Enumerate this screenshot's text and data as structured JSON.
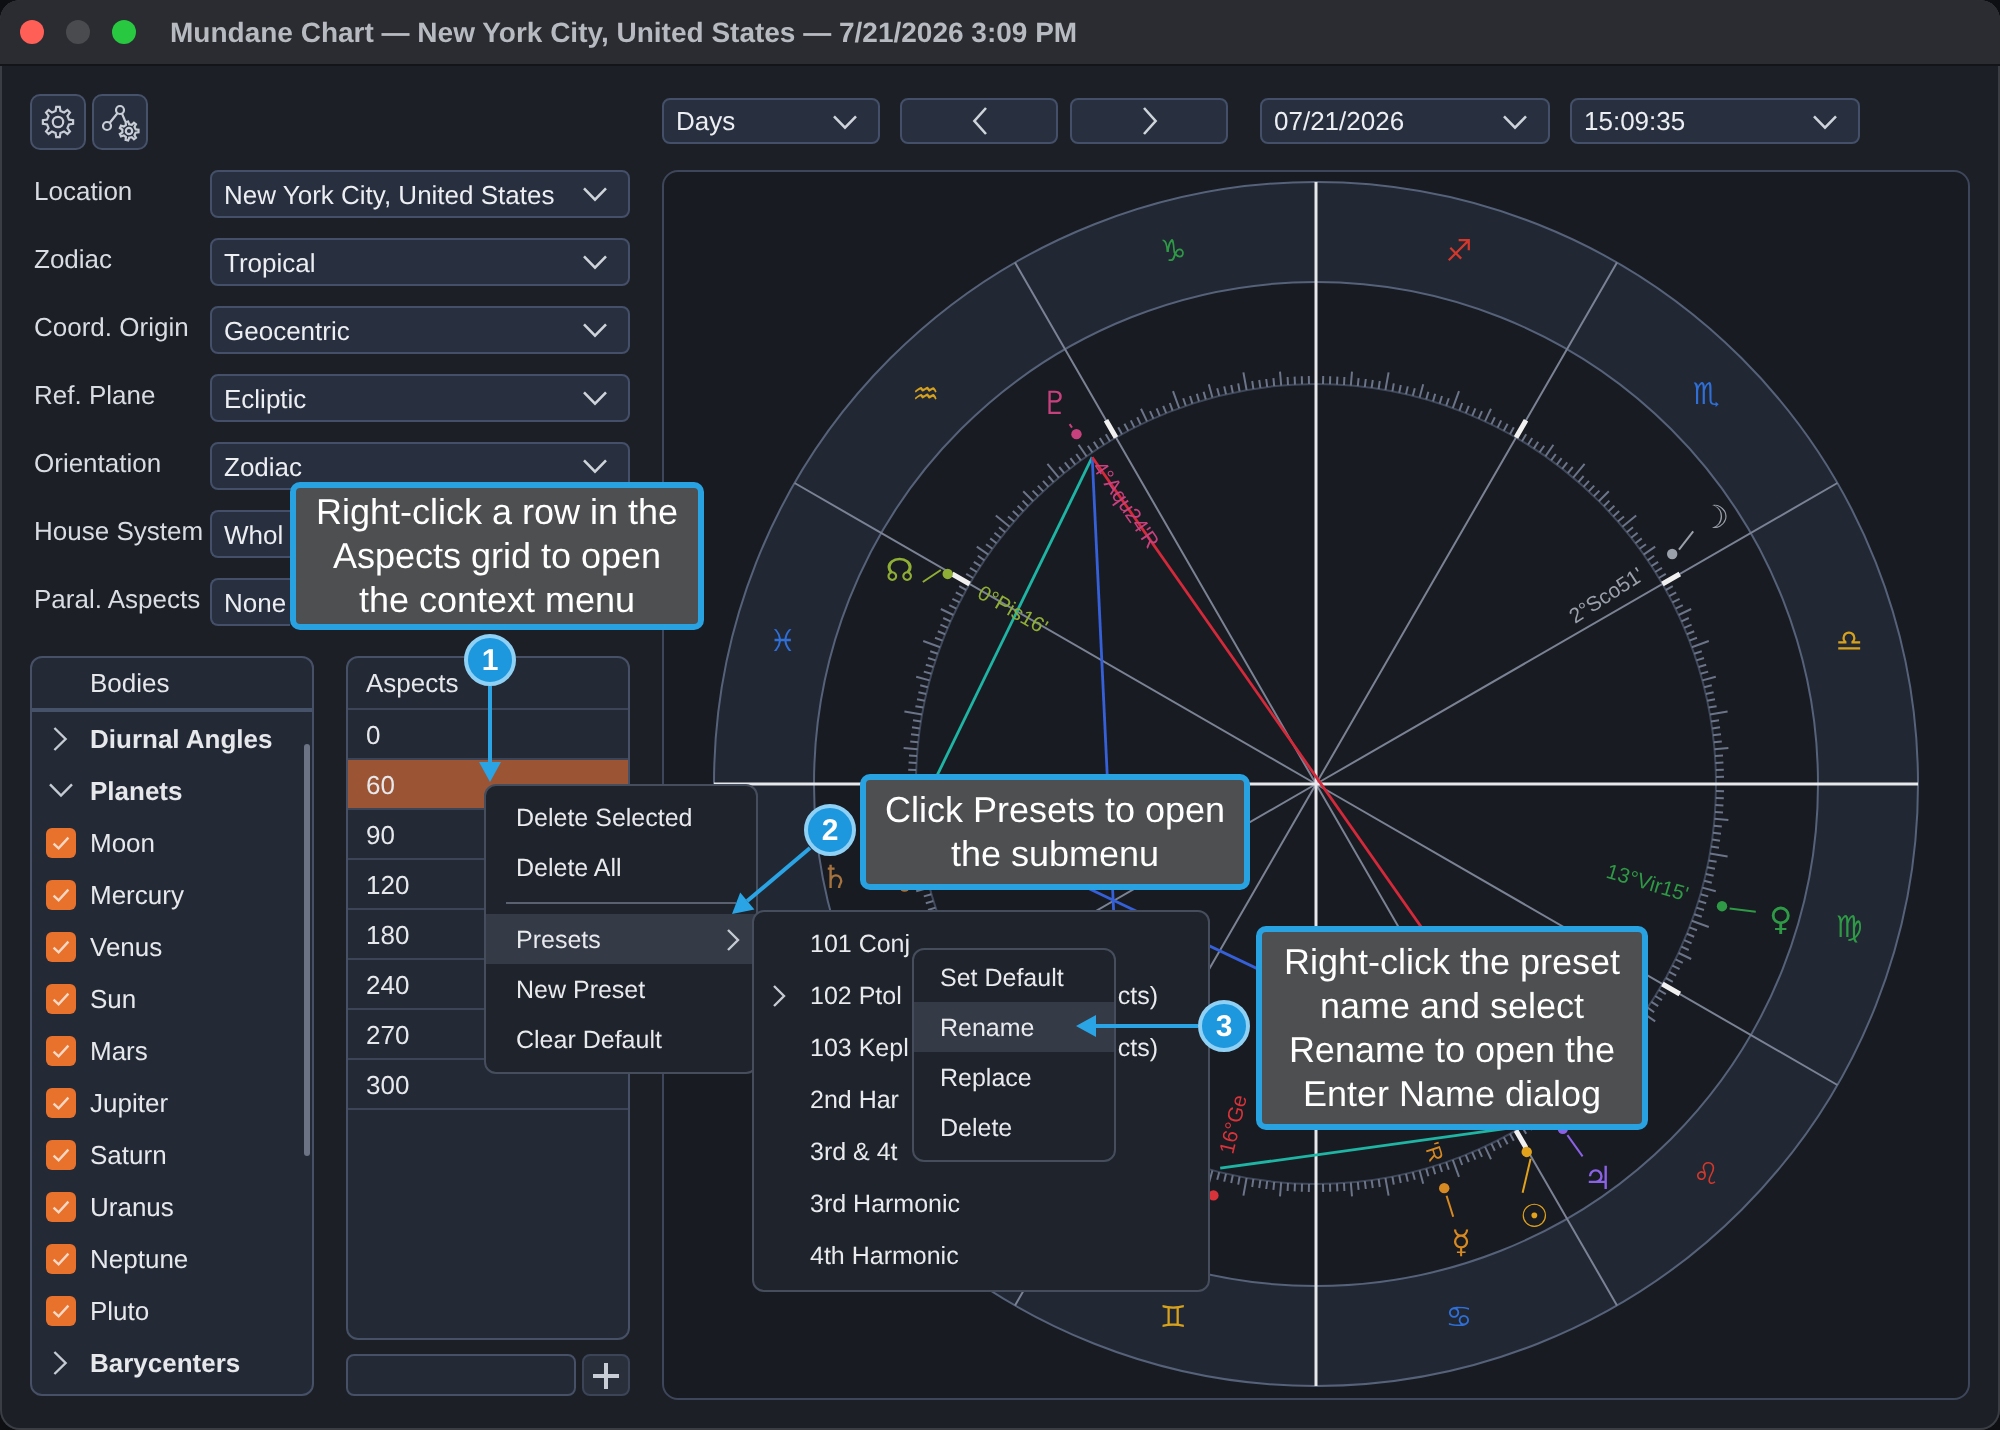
{
  "window": {
    "title": "Mundane Chart — New York City, United States — 7/21/2026 3:09 PM",
    "controls": [
      {
        "kind": "close",
        "disabled": false
      },
      {
        "kind": "minimize",
        "disabled": true
      },
      {
        "kind": "zoom",
        "disabled": false
      }
    ]
  },
  "settings": [
    {
      "label": "Location",
      "value": "New York City, United States"
    },
    {
      "label": "Zodiac",
      "value": "Tropical"
    },
    {
      "label": "Coord. Origin",
      "value": "Geocentric"
    },
    {
      "label": "Ref. Plane",
      "value": "Ecliptic"
    },
    {
      "label": "Orientation",
      "value": "Zodiac"
    },
    {
      "label": "House System",
      "value": "Whol"
    },
    {
      "label": "Paral. Aspects",
      "value": "None"
    }
  ],
  "bodies": {
    "title": "Bodies",
    "items": [
      {
        "label": "Diurnal Angles",
        "expanded": false
      },
      {
        "label": "Planets",
        "expanded": true,
        "children": [
          {
            "label": "Moon",
            "checked": true
          },
          {
            "label": "Mercury",
            "checked": true
          },
          {
            "label": "Venus",
            "checked": true
          },
          {
            "label": "Sun",
            "checked": true
          },
          {
            "label": "Mars",
            "checked": true
          },
          {
            "label": "Jupiter",
            "checked": true
          },
          {
            "label": "Saturn",
            "checked": true
          },
          {
            "label": "Uranus",
            "checked": true
          },
          {
            "label": "Neptune",
            "checked": true
          },
          {
            "label": "Pluto",
            "checked": true
          }
        ]
      },
      {
        "label": "Barycenters",
        "expanded": false
      }
    ]
  },
  "aspects": {
    "title": "Aspects",
    "rows": [
      {
        "value": "0",
        "selected": false
      },
      {
        "value": "60",
        "selected": true
      },
      {
        "value": "90",
        "selected": false
      },
      {
        "value": "120",
        "selected": false
      },
      {
        "value": "180",
        "selected": false
      },
      {
        "value": "240",
        "selected": false
      },
      {
        "value": "270",
        "selected": false
      },
      {
        "value": "300",
        "selected": false
      }
    ]
  },
  "navigation": {
    "step": "Days",
    "date": "07/21/2026",
    "time": "15:09:35"
  },
  "chart": {
    "signs": [
      {
        "glyph": "♑",
        "color": "#2f9a45"
      },
      {
        "glyph": "♐",
        "color": "#d2382c"
      },
      {
        "glyph": "♒",
        "color": "#d6a21e"
      },
      {
        "glyph": "♏",
        "color": "#2f6fd6"
      },
      {
        "glyph": "♓",
        "color": "#2f6fd6"
      },
      {
        "glyph": "♎",
        "color": "#d6a21e"
      },
      {
        "glyph": "♍",
        "color": "#2f9a45"
      },
      {
        "glyph": "♌",
        "color": "#d2382c"
      },
      {
        "glyph": "♊",
        "color": "#d6a21e"
      },
      {
        "glyph": "♋",
        "color": "#2f6fd6"
      }
    ],
    "planets": [
      {
        "glyph": "♇",
        "label": "4°Aqu24'R",
        "color": "#c8417f"
      },
      {
        "glyph": "☊",
        "label": "0°Pis16'",
        "color": "#8fae35"
      },
      {
        "glyph": "☽",
        "label": "2°Sco51'",
        "color": "#9ba1ab"
      },
      {
        "glyph": "♀",
        "label": "13°Vir15'",
        "color": "#2f9a45"
      },
      {
        "glyph": "♄",
        "color": "#a6733f"
      },
      {
        "label": "16°Ge",
        "color": "#d8333a"
      },
      {
        "glyph": "☿",
        "label": "'R",
        "color": "#d88a22"
      },
      {
        "glyph": "☉",
        "color": "#e2a21c"
      },
      {
        "glyph": "♃",
        "color": "#8b62e6"
      }
    ]
  },
  "context_menu": {
    "items": [
      {
        "kind": "item",
        "label": "Delete Selected",
        "highlighted": false
      },
      {
        "kind": "item",
        "label": "Delete All",
        "highlighted": false
      },
      {
        "kind": "separator"
      },
      {
        "kind": "submenu",
        "label": "Presets",
        "highlighted": true
      },
      {
        "kind": "item",
        "label": "New Preset",
        "highlighted": false
      },
      {
        "kind": "item",
        "label": "Clear Default",
        "highlighted": false
      }
    ]
  },
  "presets_menu": {
    "items": [
      {
        "label": "101 Conj",
        "submenu_open": false
      },
      {
        "label": "102 Ptol",
        "label_end": "cts)",
        "submenu_open": true
      },
      {
        "label": "103 Kepl",
        "label_end": "cts)",
        "submenu_open": false
      },
      {
        "label": "2nd Har",
        "submenu_open": false
      },
      {
        "label": "3rd & 4t",
        "submenu_open": false
      },
      {
        "label": "3rd Harmonic",
        "submenu_open": false
      },
      {
        "label": "4th Harmonic",
        "submenu_open": false
      }
    ]
  },
  "preset_actions_menu": {
    "items": [
      {
        "label": "Set Default",
        "highlighted": false
      },
      {
        "label": "Rename",
        "highlighted": true
      },
      {
        "label": "Replace",
        "highlighted": false
      },
      {
        "label": "Delete",
        "highlighted": false
      }
    ]
  },
  "callouts": [
    {
      "number": "1",
      "text": "Right-click a row in the Aspects grid to open the context menu"
    },
    {
      "number": "2",
      "text": "Click Presets to open the submenu"
    },
    {
      "number": "3",
      "text": "Right-click the preset name and select Rename to open the Enter Name dialog"
    }
  ]
}
